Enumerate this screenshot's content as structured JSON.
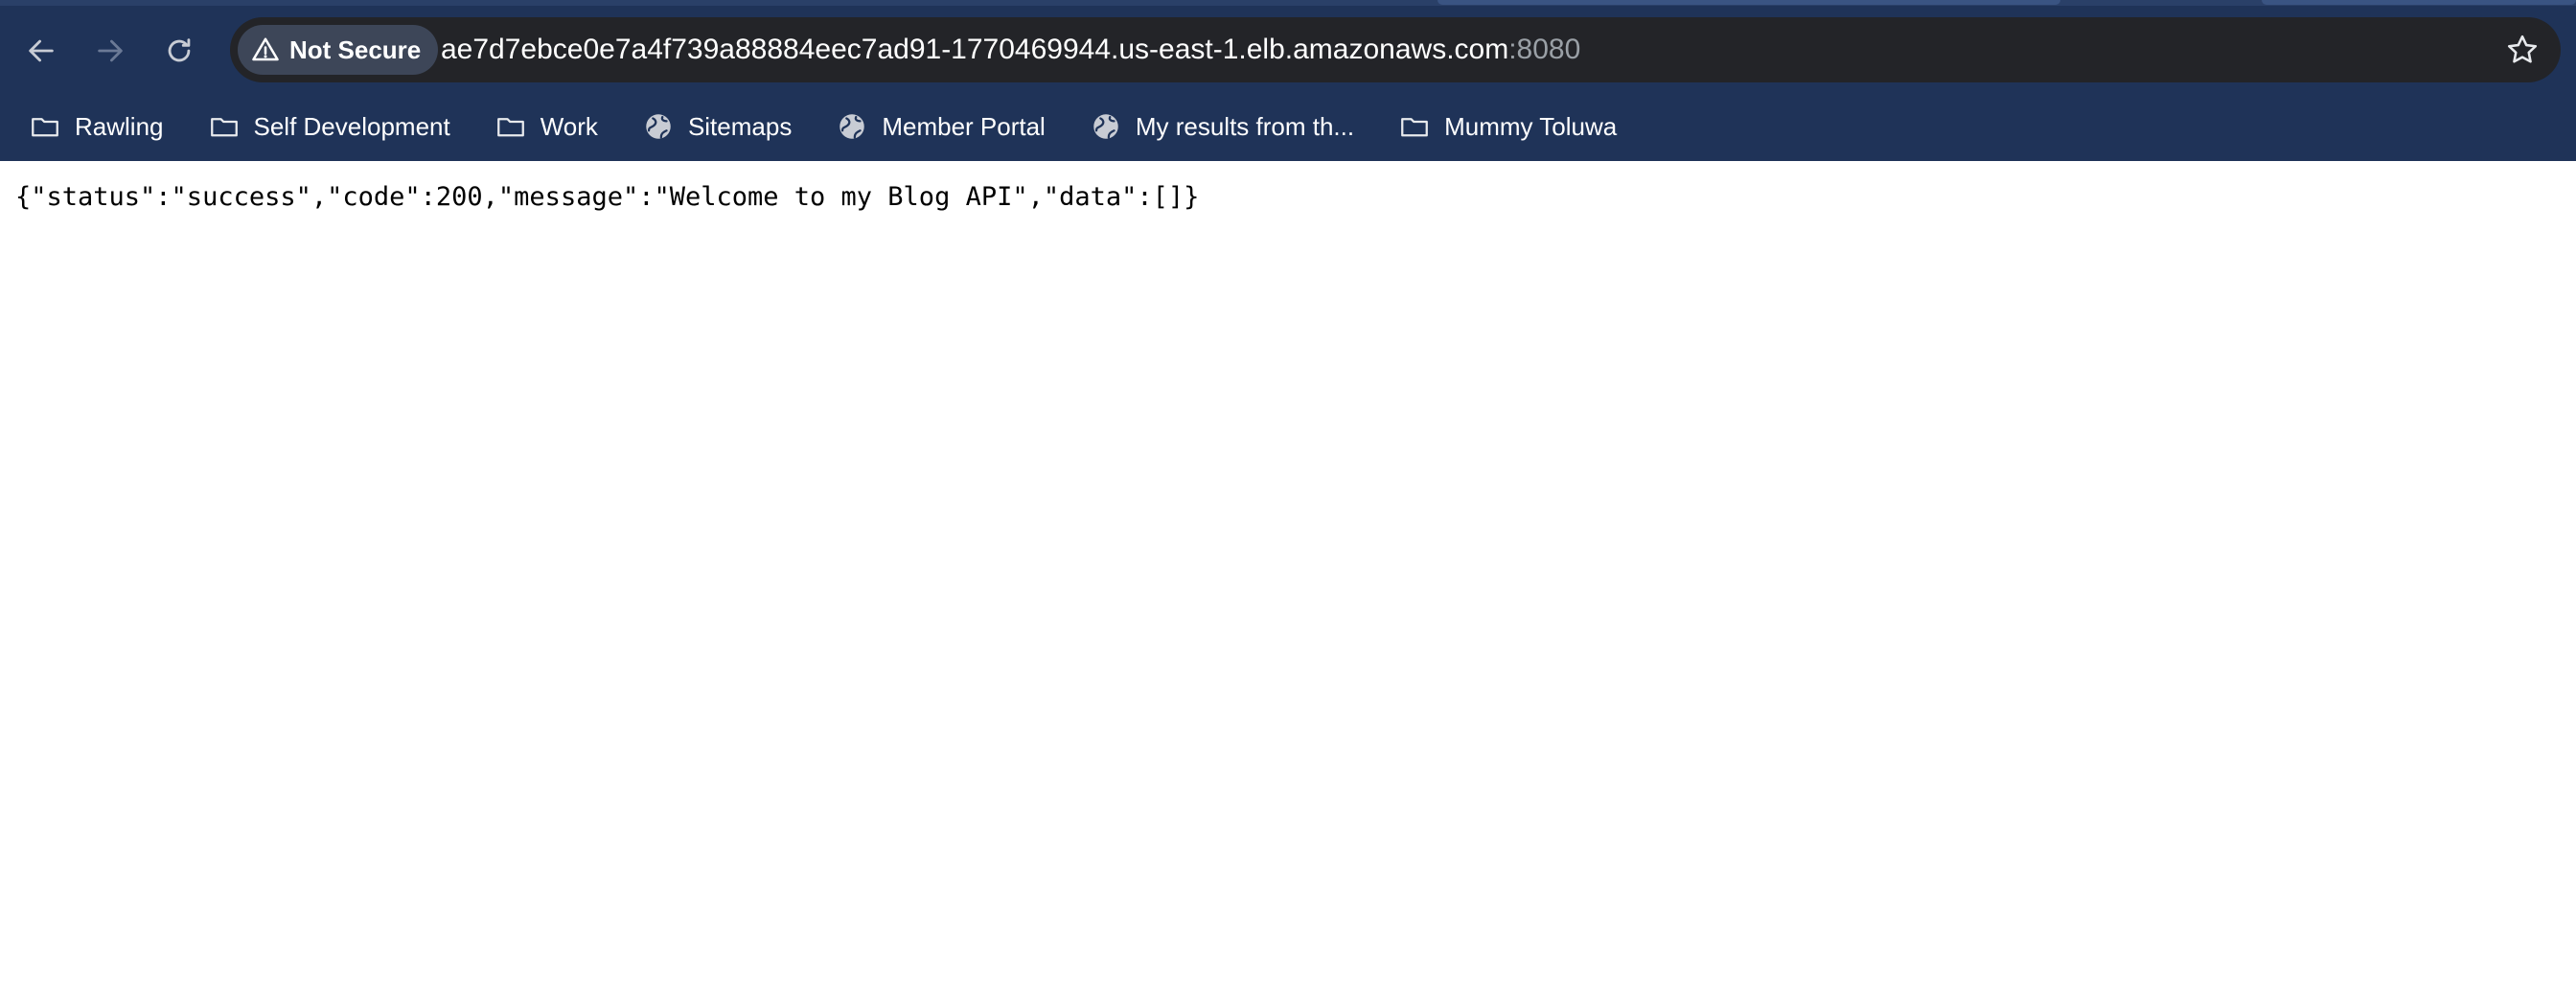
{
  "browser": {
    "nav": {
      "back_icon": "arrow-left-icon",
      "forward_icon": "arrow-right-icon",
      "reload_icon": "reload-icon"
    },
    "omnibox": {
      "security_label": "Not Secure",
      "security_icon": "warning-triangle-icon",
      "url_host": "ae7d7ebce0e7a4f739a88884eec7ad91-1770469944.us-east-1.elb.amazonaws.com",
      "url_port": ":8080",
      "bookmark_star_icon": "star-icon"
    },
    "bookmarks": [
      {
        "label": "Rawling",
        "icon": "folder-icon"
      },
      {
        "label": "Self Development",
        "icon": "folder-icon"
      },
      {
        "label": "Work",
        "icon": "folder-icon"
      },
      {
        "label": "Sitemaps",
        "icon": "globe-icon"
      },
      {
        "label": "Member Portal",
        "icon": "globe-icon"
      },
      {
        "label": "My results from th...",
        "icon": "globe-icon"
      },
      {
        "label": "Mummy Toluwa",
        "icon": "folder-icon"
      }
    ]
  },
  "page": {
    "body_text": "{\"status\":\"success\",\"code\":200,\"message\":\"Welcome to my Blog API\",\"data\":[]}"
  },
  "colors": {
    "chrome_bg": "#1f3358",
    "omnibox_bg": "#232428",
    "page_bg": "#ffffff"
  }
}
